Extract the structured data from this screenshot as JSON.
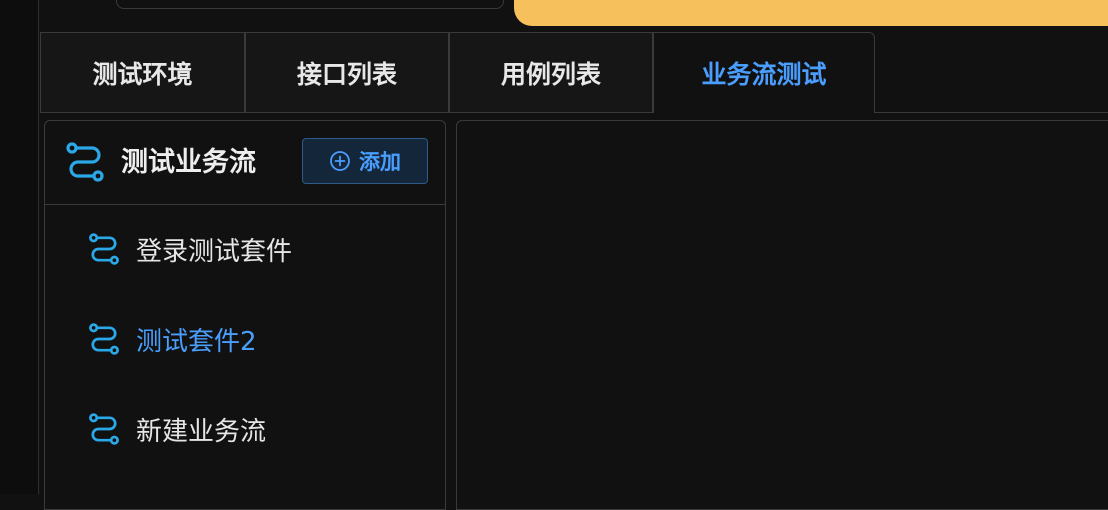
{
  "tabs": [
    {
      "label": "测试环境"
    },
    {
      "label": "接口列表"
    },
    {
      "label": "用例列表"
    },
    {
      "label": "业务流测试"
    }
  ],
  "active_tab": "业务流测试",
  "sidebar": {
    "title": "测试业务流",
    "add_label": "添加",
    "items": [
      {
        "label": "登录测试套件"
      },
      {
        "label": "测试套件2"
      },
      {
        "label": "新建业务流"
      }
    ],
    "selected_item": "测试套件2"
  },
  "icons": {
    "header": "flow-icon",
    "add": "circle-plus-icon",
    "item": "flow-icon"
  },
  "colors": {
    "accent": "#4a9eff",
    "icon": "#2aa8e8",
    "banner": "#f6c15c",
    "background": "#111111",
    "border": "#3a3a3a"
  }
}
